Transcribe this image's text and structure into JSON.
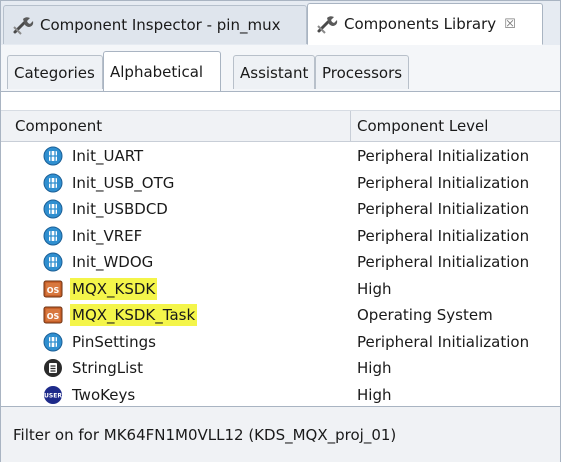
{
  "view_tabs": [
    {
      "label": "Component Inspector - pin_mux",
      "icon": "inspector-wrench-icon"
    },
    {
      "label": "Components Library",
      "icon": "library-wrench-icon",
      "close_icon": "close-icon",
      "close_glyph": "☒"
    }
  ],
  "sub_tabs": [
    {
      "label": "Categories"
    },
    {
      "label": "Alphabetical",
      "selected": true
    },
    {
      "label": "Assistant"
    },
    {
      "label": "Processors"
    }
  ],
  "table": {
    "columns": [
      "Component",
      "Component Level"
    ],
    "rows": [
      {
        "name": "Init_UART",
        "level": "Peripheral Initialization",
        "icon": "init-component-icon"
      },
      {
        "name": "Init_USB_OTG",
        "level": "Peripheral Initialization",
        "icon": "init-component-icon"
      },
      {
        "name": "Init_USBDCD",
        "level": "Peripheral Initialization",
        "icon": "init-component-icon"
      },
      {
        "name": "Init_VREF",
        "level": "Peripheral Initialization",
        "icon": "init-component-icon"
      },
      {
        "name": "Init_WDOG",
        "level": "Peripheral Initialization",
        "icon": "init-component-icon"
      },
      {
        "name": "MQX_KSDK",
        "level": "High",
        "icon": "os-component-icon",
        "highlighted": true
      },
      {
        "name": "MQX_KSDK_Task",
        "level": "Operating System",
        "icon": "os-component-icon",
        "highlighted": true
      },
      {
        "name": "PinSettings",
        "level": "Peripheral Initialization",
        "icon": "init-component-icon"
      },
      {
        "name": "StringList",
        "level": "High",
        "icon": "high-level-component-icon"
      },
      {
        "name": "TwoKeys",
        "level": "High",
        "icon": "user-component-icon"
      }
    ]
  },
  "status_bar": {
    "text": "Filter on for MK64FN1M0VLL12 (KDS_MQX_proj_01)"
  },
  "colors": {
    "highlight": "#f4f54a",
    "init_icon": "#2f8fd0",
    "os_icon": "#c8612a",
    "user_icon": "#1d2a8a"
  }
}
